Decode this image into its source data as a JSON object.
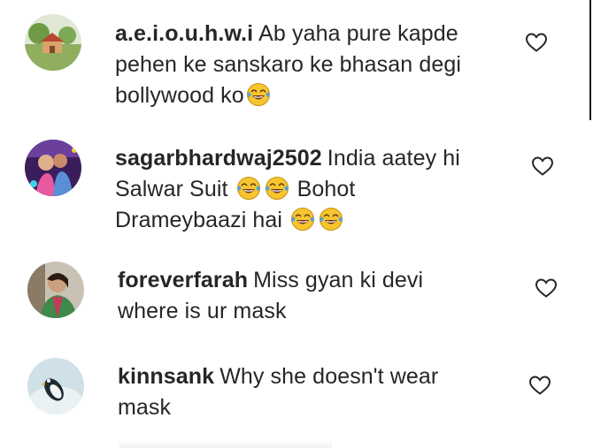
{
  "comments": [
    {
      "username": "a.e.i.o.u.h.w.i",
      "lines": [
        "Ab yaha pure kapde",
        "pehen ke sanskaro ke bhasan degi",
        "bollywood ko"
      ],
      "avatar_icon": "avatar-house-landscape",
      "like_icon": "heart-outline-icon"
    },
    {
      "username": "sagarbhardwaj2502",
      "lines": [
        "India aatey hi",
        "Salwar Suit",
        "Bohot",
        "Drameybaazi hai"
      ],
      "avatar_icon": "avatar-couple-photo",
      "like_icon": "heart-outline-icon"
    },
    {
      "username": "foreverfarah",
      "lines": [
        "Miss gyan ki devi",
        "where is ur mask"
      ],
      "avatar_icon": "avatar-woman-portrait",
      "like_icon": "heart-outline-icon"
    },
    {
      "username": "kinnsank",
      "lines": [
        "Why she doesn't wear",
        "mask"
      ],
      "avatar_icon": "avatar-penguin",
      "like_icon": "heart-outline-icon"
    }
  ],
  "emoji": {
    "name": "face-with-tears-of-joy",
    "face_color": "#F7C52E",
    "tear_color": "#4AA3E8"
  },
  "colors": {
    "text": "#262626",
    "icon": "#262626",
    "background": "#ffffff"
  }
}
